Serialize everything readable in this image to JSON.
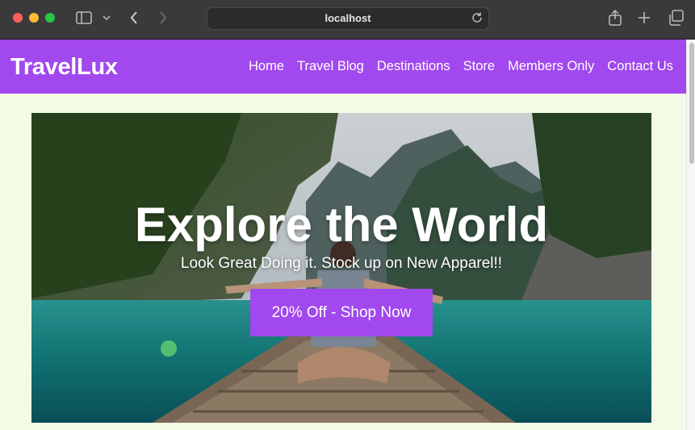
{
  "browser": {
    "address": "localhost",
    "icons": [
      "sidebar-icon",
      "chevron-down-icon",
      "back-icon",
      "forward-icon",
      "reload-icon",
      "share-icon",
      "new-tab-icon",
      "tabs-icon"
    ]
  },
  "site": {
    "brand": "TravelLux",
    "nav": [
      "Home",
      "Travel Blog",
      "Destinations",
      "Store",
      "Members Only",
      "Contact Us"
    ],
    "accent": "#a148ee",
    "background": "#f3fbe6"
  },
  "hero": {
    "title": "Explore the World",
    "subtitle": "Look Great Doing it. Stock up on New Apparel!!",
    "cta": "20% Off - Shop Now"
  }
}
